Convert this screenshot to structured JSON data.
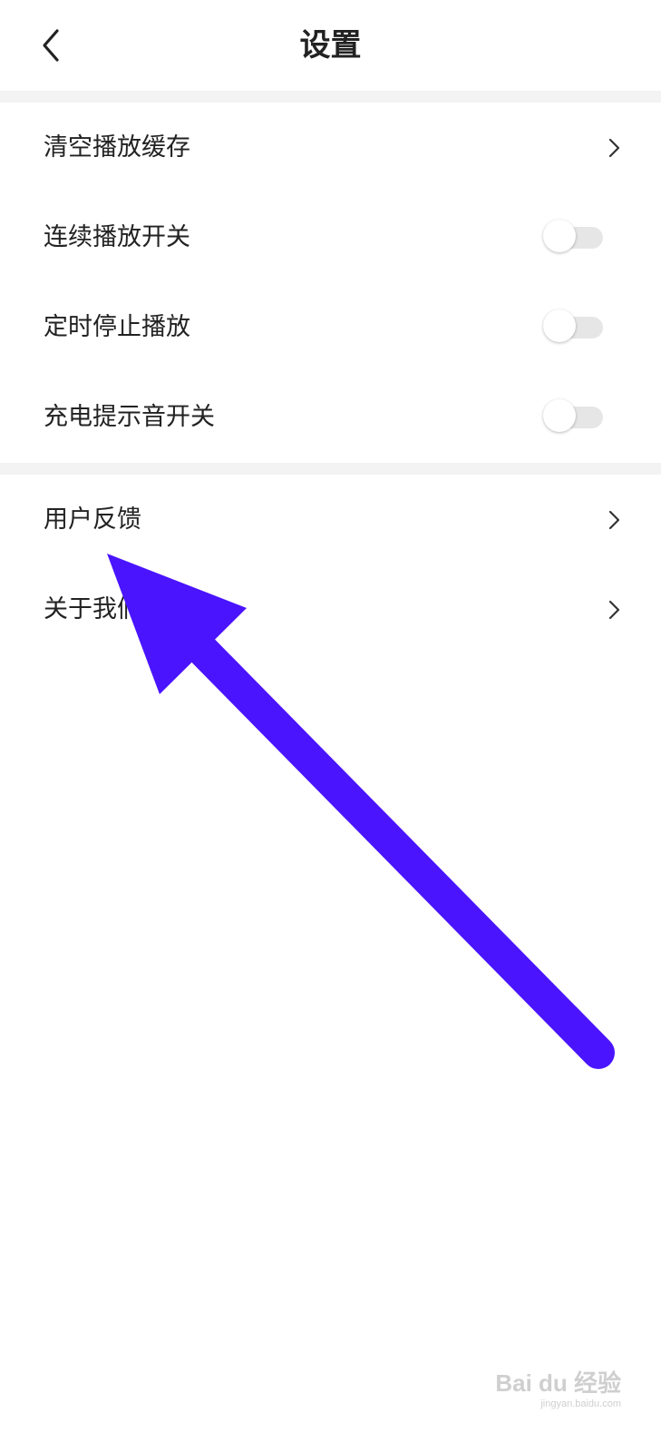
{
  "header": {
    "title": "设置",
    "back_icon": "chevron-left-icon"
  },
  "section1": {
    "items": [
      {
        "label": "清空播放缓存",
        "control": "chevron"
      },
      {
        "label": "连续播放开关",
        "control": "toggle",
        "on": false
      },
      {
        "label": "定时停止播放",
        "control": "toggle",
        "on": false
      },
      {
        "label": "充电提示音开关",
        "control": "toggle",
        "on": false
      }
    ]
  },
  "section2": {
    "items": [
      {
        "label": "用户反馈",
        "control": "chevron"
      },
      {
        "label": "关于我们",
        "control": "chevron"
      }
    ]
  },
  "annotation": {
    "color": "#4a14ff"
  },
  "watermark": {
    "main": "Bai du 经验",
    "sub": "jingyan.baidu.com"
  },
  "colors": {
    "background": "#ffffff",
    "section_gap": "#f3f3f3",
    "text": "#222222",
    "toggle_off_track": "#e6e6e6"
  }
}
